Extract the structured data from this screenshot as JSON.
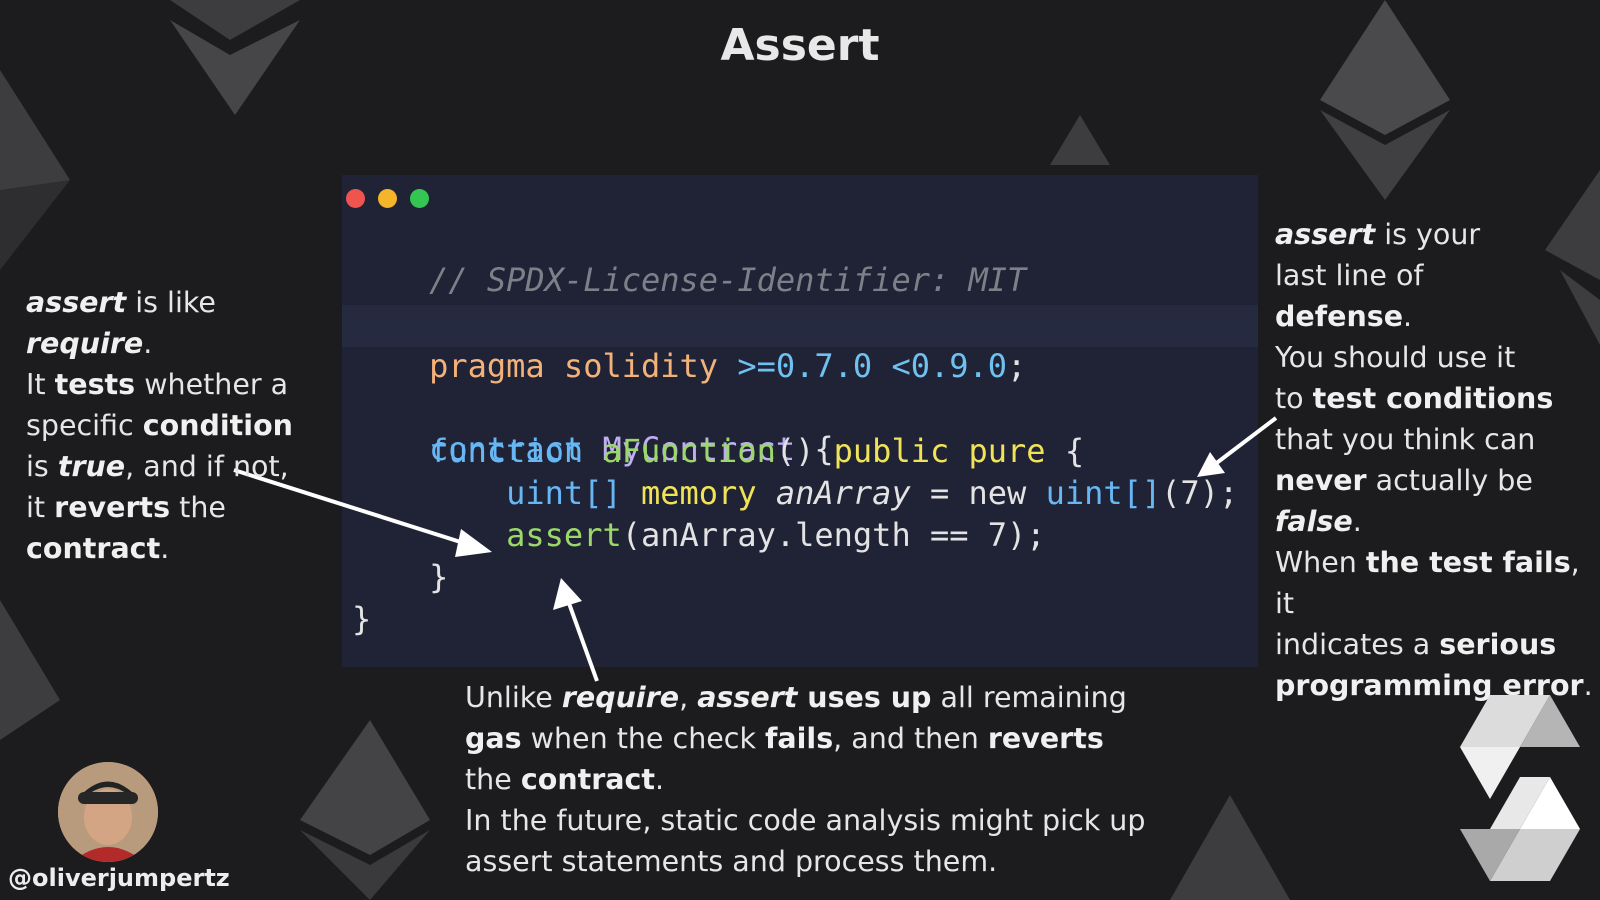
{
  "title": "Assert",
  "code": {
    "comment": "// SPDX-License-Identifier: MIT",
    "pragma_kw": "pragma solidity",
    "pragma_ver": ">=0.7.0 <0.9.0",
    "pragma_end": ";",
    "contract_kw": "contract",
    "contract_name": "MyContract",
    "contract_open": "{",
    "function_kw": "function",
    "function_name": "aFunction",
    "function_parens": "()",
    "public_kw": "public",
    "pure_kw": "pure",
    "function_open": "{",
    "uint_kw": "uint[]",
    "memory_kw": "memory",
    "var_name": "anArray",
    "assign": "= new",
    "uint_new": "uint[]",
    "new_args": "(7);",
    "assert_kw": "assert",
    "assert_args": "(anArray.length == 7);",
    "fn_close": "}",
    "contract_close": "}"
  },
  "notes": {
    "left": {
      "p1": "assert",
      "p2": " is like ",
      "p3": "require",
      "p4": ".",
      "p5": "It ",
      "p6": "tests",
      "p7": " whether a",
      "p8": "specific ",
      "p9": "condition",
      "p10": "is ",
      "p11": "true",
      "p12": ", and if not,",
      "p13": "it ",
      "p14": "reverts",
      "p15": " the",
      "p16": "contract",
      "p17": "."
    },
    "right": {
      "p1": "assert",
      "p2": " is your",
      "p3": "last line of",
      "p4": "defense",
      "p5": ".",
      "p6": "You should use it",
      "p7": "to ",
      "p8": "test conditions",
      "p9": "that",
      "p10": " you think can",
      "p11": "never",
      "p12": " actually be",
      "p13": "false",
      "p14": ".",
      "p15": "When ",
      "p16": "the test fails",
      "p17": ", it",
      "p18": "indicates a ",
      "p19": "serious",
      "p20": "programming error",
      "p21": "."
    },
    "bottom": {
      "p1": "Unlike ",
      "p2": "require",
      "p3": ", ",
      "p4": "assert",
      "p5": " uses up",
      "p6": " all remaining",
      "p7": "gas",
      "p8": " when the check ",
      "p9": "fails",
      "p10": ", and then ",
      "p11": "reverts",
      "p12": "the ",
      "p13": "contract",
      "p14": ".",
      "p15": "In the future, static code analysis might pick up",
      "p16": "assert statements and process them."
    }
  },
  "author": {
    "handle": "@oliverjumpertz"
  },
  "colors": {
    "background": "#1c1c1e",
    "editor": "#202335",
    "eth_shape": "#4a4a4a"
  }
}
